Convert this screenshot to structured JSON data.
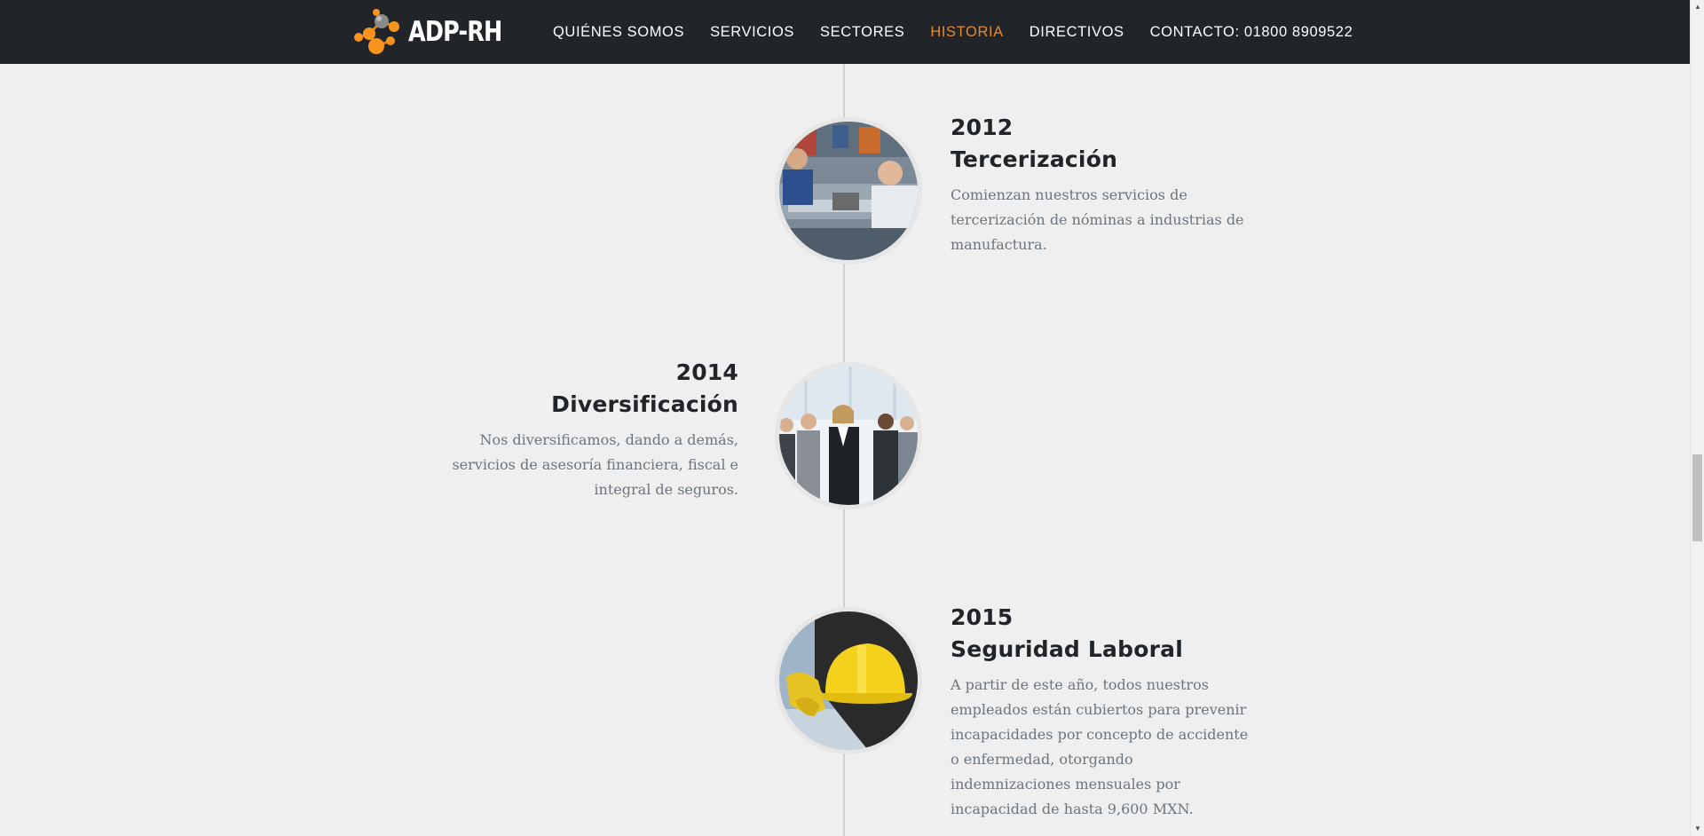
{
  "brand": {
    "name": "ADP-RH",
    "accent_color": "#f7941d"
  },
  "nav": {
    "items": [
      {
        "label": "QUIÉNES SOMOS"
      },
      {
        "label": "SERVICIOS"
      },
      {
        "label": "SECTORES"
      },
      {
        "label": "HISTORIA"
      },
      {
        "label": "DIRECTIVOS"
      },
      {
        "label": "CONTACTO: 01800 8909522"
      }
    ],
    "active_color": "#e8892a"
  },
  "timeline": [
    {
      "year": "2012",
      "title": "Tercerización",
      "description": "Comienzan nuestros servicios de tercerización de nóminas a industrias de manufactura.",
      "image": "factory-workers-photo"
    },
    {
      "year": "2014",
      "title": "Diversificación",
      "description": "Nos diversificamos, dando a demás, servicios de asesoría financiera, fiscal e integral de seguros.",
      "image": "business-team-photo"
    },
    {
      "year": "2015",
      "title": "Seguridad Laboral",
      "description": "A partir de este año, todos nuestros empleados están cubiertos para prevenir incapacidades por concepto de accidente o enfermedad, otorgando indemnizaciones mensuales por incapacidad de hasta 9,600 MXN.",
      "image": "hard-hat-photo"
    }
  ]
}
